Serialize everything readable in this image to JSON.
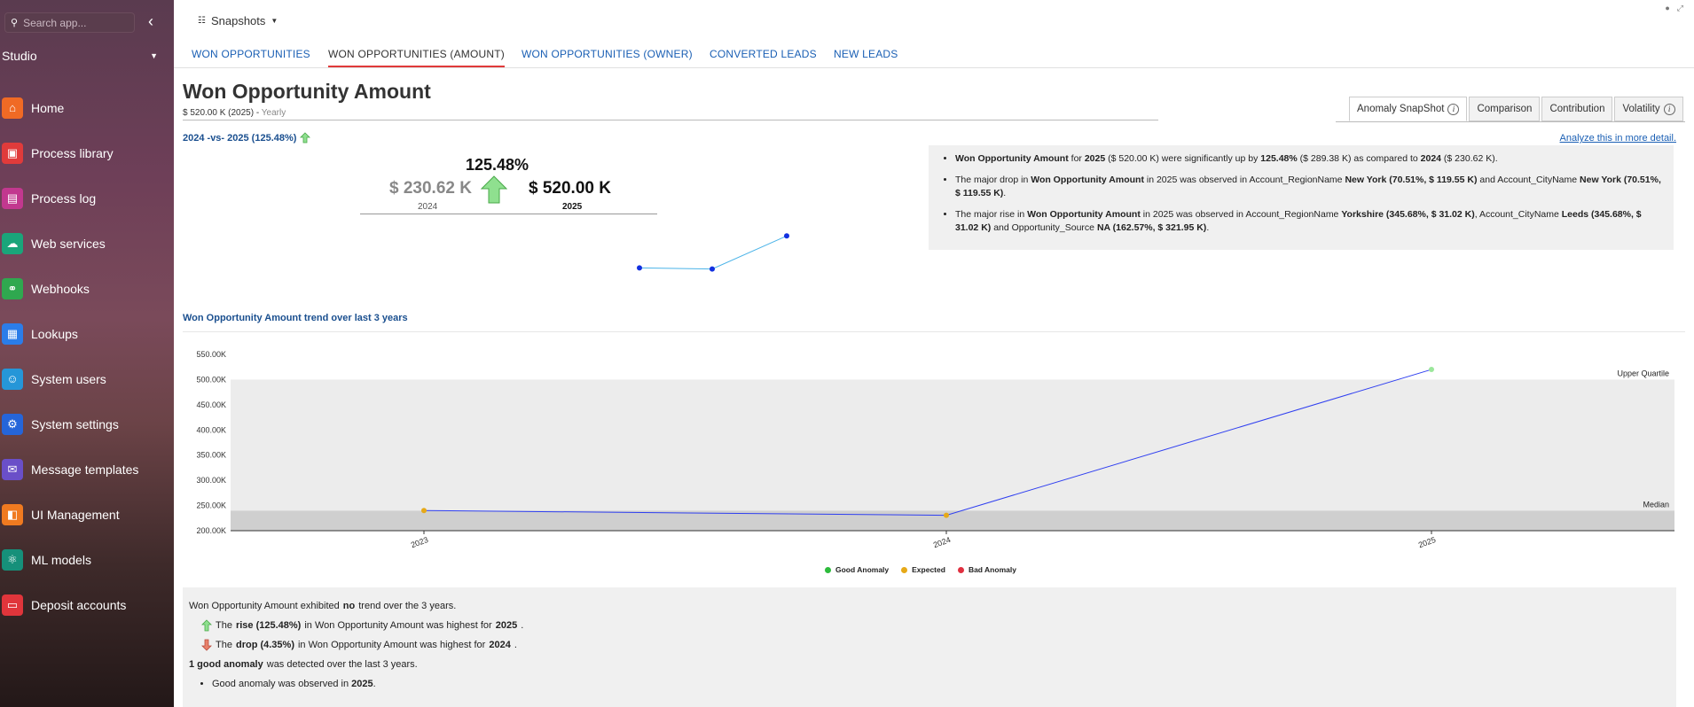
{
  "sidebar": {
    "search_placeholder": "Search app...",
    "workspace": "Studio",
    "items": [
      {
        "label": "Home",
        "icon": "home-icon",
        "color": "#f06a25",
        "glyph": "⌂"
      },
      {
        "label": "Process library",
        "icon": "process-library-icon",
        "color": "#e03b3b",
        "glyph": "▣"
      },
      {
        "label": "Process log",
        "icon": "process-log-icon",
        "color": "#c2388f",
        "glyph": "▤"
      },
      {
        "label": "Web services",
        "icon": "web-services-icon",
        "color": "#1aa57a",
        "glyph": "☁"
      },
      {
        "label": "Webhooks",
        "icon": "webhooks-icon",
        "color": "#2fa84f",
        "glyph": "⚭"
      },
      {
        "label": "Lookups",
        "icon": "lookups-icon",
        "color": "#2b7de9",
        "glyph": "▦"
      },
      {
        "label": "System users",
        "icon": "system-users-icon",
        "color": "#2596d8",
        "glyph": "☺"
      },
      {
        "label": "System settings",
        "icon": "system-settings-icon",
        "color": "#2565d9",
        "glyph": "⚙"
      },
      {
        "label": "Message templates",
        "icon": "message-templates-icon",
        "color": "#6a4fc8",
        "glyph": "✉"
      },
      {
        "label": "UI Management",
        "icon": "ui-management-icon",
        "color": "#f07a20",
        "glyph": "◧"
      },
      {
        "label": "ML models",
        "icon": "ml-models-icon",
        "color": "#16907a",
        "glyph": "⚛"
      },
      {
        "label": "Deposit accounts",
        "icon": "deposit-accounts-icon",
        "color": "#e0353b",
        "glyph": "▭"
      }
    ]
  },
  "topbar": {
    "dropdown_label": "Snapshots"
  },
  "tabs": [
    {
      "label": "WON OPPORTUNITIES",
      "active": false
    },
    {
      "label": "WON OPPORTUNITIES (AMOUNT)",
      "active": true
    },
    {
      "label": "WON OPPORTUNITIES (OWNER)",
      "active": false
    },
    {
      "label": "CONVERTED LEADS",
      "active": false
    },
    {
      "label": "NEW LEADS",
      "active": false
    }
  ],
  "page": {
    "title": "Won Opportunity Amount",
    "subtitle_value": "$ 520.00 K (2025) - ",
    "subtitle_period": "Yearly"
  },
  "view_tabs": [
    {
      "label": "Anomaly SnapShot",
      "info": true,
      "active": true
    },
    {
      "label": "Comparison",
      "info": false,
      "active": false
    },
    {
      "label": "Contribution",
      "info": false,
      "active": false
    },
    {
      "label": "Volatility",
      "info": true,
      "active": false
    }
  ],
  "comparison": {
    "label": "2024 -vs- 2025 (125.48%)",
    "analyze_link": "Analyze this in more detail.",
    "pct": "125.48%",
    "prev_value": "$ 230.62 K",
    "prev_year": "2024",
    "curr_value": "$ 520.00 K",
    "curr_year": "2025",
    "sparkline": [
      240,
      230.62,
      520
    ]
  },
  "summary": {
    "b1": {
      "a": "Won Opportunity Amount",
      "b": " for ",
      "c": "2025",
      "d": " ($ 520.00 K) were significantly up by ",
      "e": "125.48%",
      "f": " ($ 289.38 K) as compared to ",
      "g": "2024",
      "h": " ($ 230.62 K)."
    },
    "b2": {
      "a": "The major drop in ",
      "b": "Won Opportunity Amount",
      "c": " in 2025 was observed in Account_RegionName ",
      "d": "New York (70.51%, $ 119.55 K)",
      "e": " and Account_CityName ",
      "f": "New York (70.51%, $ 119.55 K)",
      "g": "."
    },
    "b3": {
      "a": "The major rise in ",
      "b": "Won Opportunity Amount",
      "c": " in 2025 was observed in Account_RegionName ",
      "d": "Yorkshire (345.68%, $ 31.02 K)",
      "e": ", Account_CityName ",
      "f": "Leeds (345.68%, $ 31.02 K)",
      "g": " and Opportunity_Source ",
      "h": "NA (162.57%, $ 321.95 K)",
      "i": "."
    }
  },
  "trend": {
    "title": "Won Opportunity Amount trend over last 3 years"
  },
  "chart_data": {
    "type": "line",
    "categories": [
      "2023",
      "2024",
      "2025"
    ],
    "series": [
      {
        "values": [
          240,
          230.62,
          520
        ]
      }
    ],
    "point_status": [
      "Expected",
      "Expected",
      "Good Anomaly"
    ],
    "ylim": [
      200,
      550
    ],
    "yticks": [
      200,
      250,
      300,
      350,
      400,
      450,
      500,
      550
    ],
    "ytick_labels": [
      "200.00K",
      "250.00K",
      "300.00K",
      "350.00K",
      "400.00K",
      "450.00K",
      "500.00K",
      "550.00K"
    ],
    "bands": [
      {
        "from": 200,
        "to": 240,
        "color": "#cfcfcf"
      },
      {
        "from": 240,
        "to": 500,
        "color": "#ececec"
      }
    ],
    "reference_lines": [
      {
        "label": "Upper Quartile",
        "value": 500
      },
      {
        "label": "Median",
        "value": 240
      }
    ],
    "line_color": "#2f3ff0",
    "legend": [
      {
        "label": "Good Anomaly",
        "color": "#2dbb3c"
      },
      {
        "label": "Expected",
        "color": "#e6a918"
      },
      {
        "label": "Bad Anomaly",
        "color": "#e03040"
      }
    ],
    "legend_position": "bottom"
  },
  "insights": {
    "trend_a": "Won Opportunity Amount exhibited ",
    "trend_b": "no",
    "trend_c": " trend over the 3 years.",
    "rise_a": "The ",
    "rise_b": "rise (125.48%)",
    "rise_c": " in Won Opportunity Amount was highest for ",
    "rise_d": "2025",
    "rise_e": ".",
    "drop_a": "The ",
    "drop_b": "drop (4.35%)",
    "drop_c": " in Won Opportunity Amount was highest for ",
    "drop_d": "2024",
    "drop_e": ".",
    "anom_a": "1 good anomaly",
    "anom_b": " was detected over the last 3 years.",
    "obs_a": "Good anomaly was observed in ",
    "obs_b": "2025",
    "obs_c": "."
  }
}
